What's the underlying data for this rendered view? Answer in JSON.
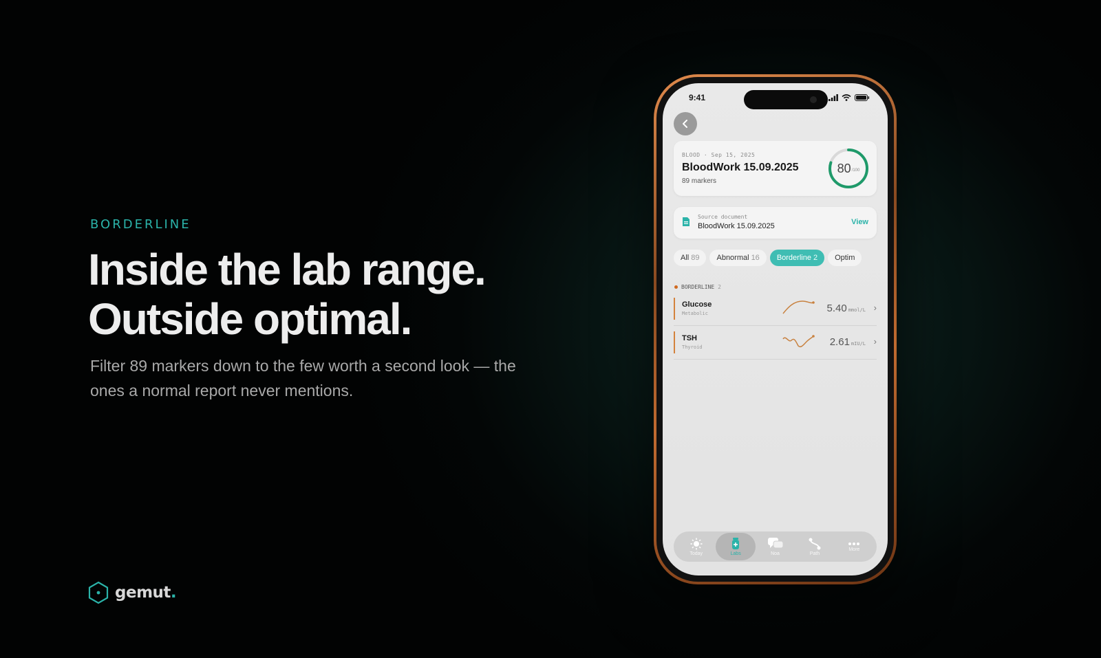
{
  "hero": {
    "eyebrow": "BORDERLINE",
    "headline_line1": "Inside the lab range.",
    "headline_line2": "Outside optimal.",
    "subtitle": "Filter 89 markers down to the few worth a second look — the ones a normal report never mentions."
  },
  "brand": {
    "name": "gemut",
    "dot": ".",
    "accent": "#2bb3a9"
  },
  "phone": {
    "status": {
      "time": "9:41"
    },
    "report": {
      "meta": "BLOOD · Sep 15, 2025",
      "title": "BloodWork 15.09.2025",
      "markers": "89 markers",
      "score": "80",
      "score_max": "/100",
      "score_fraction": 0.8
    },
    "source": {
      "label": "Source document",
      "name": "BloodWork 15.09.2025",
      "action": "View"
    },
    "filters": [
      {
        "label": "All",
        "count": "89"
      },
      {
        "label": "Abnormal",
        "count": "16"
      },
      {
        "label": "Borderline",
        "count": "2"
      },
      {
        "label": "Optim",
        "count": ""
      }
    ],
    "section": {
      "title": "BORDERLINE",
      "count": "2"
    },
    "markers_list": [
      {
        "name": "Glucose",
        "category": "Metabolic",
        "value": "5.40",
        "unit": "mmol/L"
      },
      {
        "name": "TSH",
        "category": "Thyroid",
        "value": "2.61",
        "unit": "mIU/L"
      }
    ],
    "tabs": [
      {
        "label": "Today",
        "icon": "sun-icon"
      },
      {
        "label": "Labs",
        "icon": "vial-icon"
      },
      {
        "label": "Noa",
        "icon": "chat-icon"
      },
      {
        "label": "Path",
        "icon": "path-icon"
      },
      {
        "label": "More",
        "icon": "more-icon"
      }
    ]
  }
}
